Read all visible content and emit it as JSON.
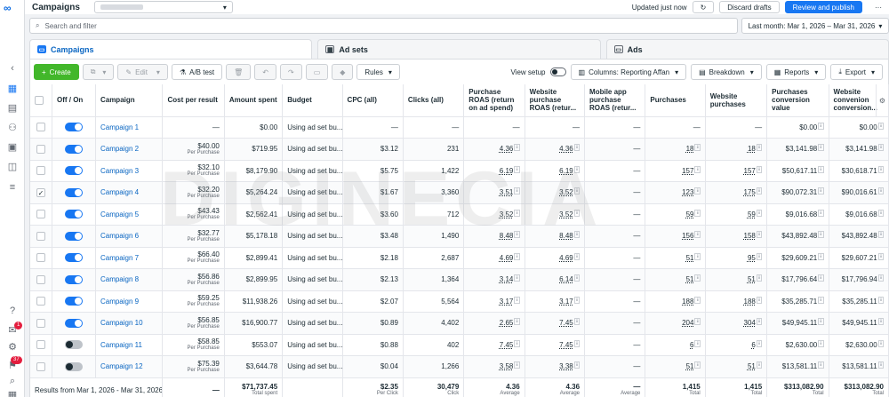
{
  "header": {
    "title": "Campaigns",
    "updated": "Updated just now",
    "discard": "Discard drafts",
    "review": "Review and publish",
    "more": "···"
  },
  "search": {
    "placeholder": "Search and filter"
  },
  "daterange": "Last month: Mar 1, 2026 – Mar 31, 2026",
  "tabs": [
    {
      "label": "Campaigns"
    },
    {
      "label": "Ad sets"
    },
    {
      "label": "Ads"
    }
  ],
  "toolbar": {
    "create": "Create",
    "edit": "Edit",
    "abtest": "A/B test",
    "rules": "Rules",
    "view_setup": "View setup",
    "columns": "Columns: Reporting Affan",
    "breakdown": "Breakdown",
    "reports": "Reports",
    "export": "Export"
  },
  "nav_badges": {
    "notifications": "1",
    "alerts": "37"
  },
  "columns": [
    "Off / On",
    "Campaign",
    "Cost per result",
    "Amount spent",
    "Budget",
    "CPC (all)",
    "Clicks (all)",
    "Purchase ROAS (return on ad spend)",
    "Website purchase ROAS (retur...",
    "Mobile app purchase ROAS (retur...",
    "Purchases",
    "Website purchases",
    "Purchases conversion value",
    "Website convenion conversion..."
  ],
  "rows": [
    {
      "name": "Campaign 1",
      "on": true,
      "checked": false,
      "cpr": "—",
      "cpr_sub": "",
      "spent": "$0.00",
      "budget": "Using ad set bu...",
      "cpc": "—",
      "clicks": "—",
      "roas": "—",
      "wroas": "—",
      "mroas": "—",
      "purch": "—",
      "wpurch": "—",
      "pcv": "$0.00",
      "wcv": "$0.00"
    },
    {
      "name": "Campaign 2",
      "on": true,
      "checked": false,
      "cpr": "$40.00",
      "cpr_sub": "Per Purchase",
      "spent": "$719.95",
      "budget": "Using ad set bu...",
      "cpc": "$3.12",
      "clicks": "231",
      "roas": "4.36",
      "wroas": "4.36",
      "mroas": "—",
      "purch": "18",
      "wpurch": "18",
      "pcv": "$3,141.98",
      "wcv": "$3,141.98"
    },
    {
      "name": "Campaign 3",
      "on": true,
      "checked": false,
      "cpr": "$32.10",
      "cpr_sub": "Per Purchase",
      "spent": "$8,179.90",
      "budget": "Using ad set bu...",
      "cpc": "$5.75",
      "clicks": "1,422",
      "roas": "6.19",
      "wroas": "6.19",
      "mroas": "—",
      "purch": "157",
      "wpurch": "157",
      "pcv": "$50,617.11",
      "wcv": "$30,618.71"
    },
    {
      "name": "Campaign 4",
      "on": true,
      "checked": true,
      "cpr": "$32.20",
      "cpr_sub": "Per Purchase",
      "spent": "$5,264.24",
      "budget": "Using ad set bu...",
      "cpc": "$1.67",
      "clicks": "3,360",
      "roas": "3.51",
      "wroas": "3.52",
      "mroas": "—",
      "purch": "123",
      "wpurch": "175",
      "pcv": "$90,072.31",
      "wcv": "$90,016.61"
    },
    {
      "name": "Campaign 5",
      "on": true,
      "checked": false,
      "cpr": "$43.43",
      "cpr_sub": "Per Purchase",
      "spent": "$2,562.41",
      "budget": "Using ad set bu...",
      "cpc": "$3.60",
      "clicks": "712",
      "roas": "3.52",
      "wroas": "3.52",
      "mroas": "—",
      "purch": "59",
      "wpurch": "59",
      "pcv": "$9,016.68",
      "wcv": "$9,016.68"
    },
    {
      "name": "Campaign 6",
      "on": true,
      "checked": false,
      "cpr": "$32.77",
      "cpr_sub": "Per Purchase",
      "spent": "$5,178.18",
      "budget": "Using ad set bu...",
      "cpc": "$3.48",
      "clicks": "1,490",
      "roas": "8.48",
      "wroas": "8.48",
      "mroas": "—",
      "purch": "156",
      "wpurch": "158",
      "pcv": "$43,892.48",
      "wcv": "$43,892.48"
    },
    {
      "name": "Campaign 7",
      "on": true,
      "checked": false,
      "cpr": "$66.40",
      "cpr_sub": "Per Purchase",
      "spent": "$2,899.41",
      "budget": "Using ad set bu...",
      "cpc": "$2.18",
      "clicks": "2,687",
      "roas": "4.69",
      "wroas": "4.69",
      "mroas": "—",
      "purch": "51",
      "wpurch": "95",
      "pcv": "$29,609.21",
      "wcv": "$29,607.21"
    },
    {
      "name": "Campaign 8",
      "on": true,
      "checked": false,
      "cpr": "$56.86",
      "cpr_sub": "Per Purchase",
      "spent": "$2,899.95",
      "budget": "Using ad set bu...",
      "cpc": "$2.13",
      "clicks": "1,364",
      "roas": "3.14",
      "wroas": "6.14",
      "mroas": "—",
      "purch": "51",
      "wpurch": "51",
      "pcv": "$17,796.64",
      "wcv": "$17,796.94"
    },
    {
      "name": "Campaign 9",
      "on": true,
      "checked": false,
      "cpr": "$59.25",
      "cpr_sub": "Per Purchase",
      "spent": "$11,938.26",
      "budget": "Using ad set bu...",
      "cpc": "$2.07",
      "clicks": "5,564",
      "roas": "3.17",
      "wroas": "3.17",
      "mroas": "—",
      "purch": "188",
      "wpurch": "188",
      "pcv": "$35,285.71",
      "wcv": "$35,285.11"
    },
    {
      "name": "Campaign 10",
      "on": true,
      "checked": false,
      "cpr": "$56.85",
      "cpr_sub": "Per Purchase",
      "spent": "$16,900.77",
      "budget": "Using ad set bu...",
      "cpc": "$0.89",
      "clicks": "4,402",
      "roas": "2.65",
      "wroas": "7.45",
      "mroas": "—",
      "purch": "204",
      "wpurch": "304",
      "pcv": "$49,945.11",
      "wcv": "$49,945.11"
    },
    {
      "name": "Campaign 11",
      "on": false,
      "checked": false,
      "cpr": "$58.85",
      "cpr_sub": "Per Purchase",
      "spent": "$553.07",
      "budget": "Using ad set bu...",
      "cpc": "$0.88",
      "clicks": "402",
      "roas": "7.45",
      "wroas": "7.45",
      "mroas": "—",
      "purch": "6",
      "wpurch": "6",
      "pcv": "$2,630.00",
      "wcv": "$2,630.00"
    },
    {
      "name": "Campaign 12",
      "on": false,
      "checked": false,
      "cpr": "$75.39",
      "cpr_sub": "Per Purchase",
      "spent": "$3,644.78",
      "budget": "Using ad set bu...",
      "cpc": "$0.04",
      "clicks": "1,266",
      "roas": "3.58",
      "wroas": "3.38",
      "mroas": "—",
      "purch": "51",
      "wpurch": "51",
      "pcv": "$13,581.11",
      "wcv": "$13,581.11"
    }
  ],
  "totals": {
    "label": "Results from Mar 1, 2026 - Mar 31, 2026",
    "cpr": "—",
    "spent": "$71,737.45",
    "spent_sub": "Total spent",
    "budget": "",
    "cpc": "$2.35",
    "cpc_sub": "Per Click",
    "clicks": "30,479",
    "clicks_sub": "Click",
    "roas": "4.36",
    "roas_sub": "Average",
    "wroas": "4.36",
    "wroas_sub": "Average",
    "mroas": "—",
    "mroas_sub": "Average",
    "purch": "1,415",
    "purch_sub": "Total",
    "wpurch": "1,415",
    "wpurch_sub": "Total",
    "pcv": "$313,082.90",
    "pcv_sub": "Total",
    "wcv": "$313,082.90",
    "wcv_sub": "Total"
  },
  "watermark": "DIGINECIA"
}
